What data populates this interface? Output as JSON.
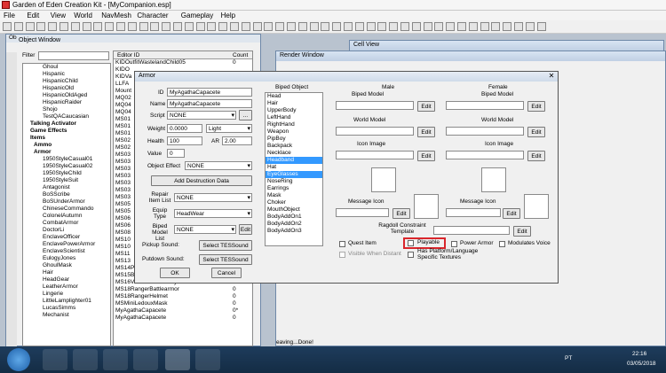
{
  "app": {
    "title": "Garden of Eden Creation Kit - [MyCompanion.esp]"
  },
  "menu": [
    "File",
    "Edit",
    "View",
    "World",
    "NavMesh",
    "Character",
    "Gameplay",
    "Help"
  ],
  "object_window": {
    "title": "Object Window",
    "filter_label": "Filter",
    "tree": [
      "Ghoul",
      "Hispanic",
      "HispanicChild",
      "HispanicOld",
      "HispanicOldAged",
      "HispanicRaider",
      "Shojo",
      "TestQACaucasian",
      "Talking Activator",
      "Game Effects",
      "Items",
      "Ammo",
      "Armor",
      "1950StyleCasual01",
      "1950StyleCasual02",
      "1950StyleChild",
      "1950StyleSuit",
      "Antagonist",
      "BoSScribe",
      "BoSUnderArmor",
      "ChineseCommando",
      "ColonelAutumn",
      "CombatArmor",
      "DoctorLi",
      "EnclaveOfficer",
      "EnclavePowerArmor",
      "EnclaveScientist",
      "EulogyJones",
      "GhoulMask",
      "Hair",
      "HeadGear",
      "LeatherArmor",
      "Lingerie",
      "LittleLamplighter01",
      "LucasSimms",
      "Mechanist"
    ],
    "col_editor_id": "Editor ID",
    "col_count": "Count",
    "list": [
      {
        "id": "KIDOutfitWastelandChild05",
        "count": "0"
      },
      {
        "id": "KIDO",
        "count": ""
      },
      {
        "id": "KIDVa",
        "count": ""
      },
      {
        "id": "LLFA",
        "count": ""
      },
      {
        "id": "Mount",
        "count": ""
      },
      {
        "id": "MQ02",
        "count": ""
      },
      {
        "id": "MQ04",
        "count": ""
      },
      {
        "id": "MQ04",
        "count": ""
      },
      {
        "id": "MS01",
        "count": ""
      },
      {
        "id": "MS01",
        "count": ""
      },
      {
        "id": "MS01",
        "count": ""
      },
      {
        "id": "MS02",
        "count": ""
      },
      {
        "id": "MS02",
        "count": ""
      },
      {
        "id": "MS03",
        "count": ""
      },
      {
        "id": "MS03",
        "count": ""
      },
      {
        "id": "MS03",
        "count": ""
      },
      {
        "id": "MS03",
        "count": ""
      },
      {
        "id": "MS03",
        "count": ""
      },
      {
        "id": "MS03",
        "count": ""
      },
      {
        "id": "MS03",
        "count": ""
      },
      {
        "id": "MS05",
        "count": ""
      },
      {
        "id": "MS05",
        "count": ""
      },
      {
        "id": "MS06",
        "count": ""
      },
      {
        "id": "MS06",
        "count": ""
      },
      {
        "id": "MS08",
        "count": ""
      },
      {
        "id": "MS10",
        "count": ""
      },
      {
        "id": "MS10",
        "count": ""
      },
      {
        "id": "MS11",
        "count": ""
      },
      {
        "id": "MS13",
        "count": ""
      },
      {
        "id": "MS14PornBoredRosphrhe",
        "count": "0"
      },
      {
        "id": "MS15ButtonsWig",
        "count": "0"
      },
      {
        "id": "MS16VaultSuit101Utility",
        "count": "0"
      },
      {
        "id": "MS18RangerBattlearmor",
        "count": "0"
      },
      {
        "id": "MS18RangerHelmet",
        "count": "0"
      },
      {
        "id": "MSMiniLedouxMask",
        "count": "0"
      },
      {
        "id": "MyAgathaCapacete",
        "count": "0*"
      },
      {
        "id": "MyAgathaCapacete",
        "count": "0"
      }
    ]
  },
  "cell_view": {
    "title": "Cell View"
  },
  "render_window": {
    "title": "Render Window"
  },
  "status": "eaving...Done!",
  "armor_dialog": {
    "title": "Armor",
    "id_label": "ID",
    "id_value": "MyAgathaCapacete",
    "name_label": "Name",
    "name_value": "MyAgathaCapacete",
    "script_label": "Script",
    "script_value": "NONE",
    "weight_label": "Weight",
    "weight_value": "0.0000",
    "weight_type": "Light",
    "health_label": "Health",
    "health_value": "100",
    "ar_label": "AR",
    "ar_value": "2.00",
    "value_label": "Value",
    "value_value": "0",
    "object_effect_label": "Object Effect",
    "object_effect_value": "NONE",
    "add_destruction": "Add Destruction Data",
    "repair_label": "Repair Item List",
    "repair_value": "NONE",
    "equip_label": "Equip Type",
    "equip_value": "HeadWear",
    "biped_model_label": "Biped Model List",
    "biped_model_value": "NONE",
    "edit": "Edit",
    "pickup_label": "Pickup Sound:",
    "putdown_label": "Putdown Sound:",
    "select_sound": "Select TESSound",
    "ok": "OK",
    "cancel": "Cancel",
    "biped_object_label": "Biped Object",
    "biped_objects": [
      "Head",
      "Hair",
      "UpperBody",
      "LeftHand",
      "RightHand",
      "Weapon",
      "PipBoy",
      "Backpack",
      "Necklace",
      "Headband",
      "Hat",
      "EyeGlasses",
      "NoseRing",
      "Earrings",
      "Mask",
      "Choker",
      "MouthObject",
      "BodyAddOn1",
      "BodyAddOn2",
      "BodyAddOn3"
    ],
    "biped_selected": [
      "Headband",
      "EyeGlasses"
    ],
    "male_label": "Male",
    "female_label": "Female",
    "biped_model": "Biped Model",
    "world_model": "World Model",
    "icon_image": "Icon Image",
    "message_icon": "Message Icon",
    "ragdoll_label": "Ragdoll Constraint Template",
    "quest_item": "Quest Item",
    "playable": "Playable",
    "power_armor": "Power Armor",
    "modulates_voice": "Modulates Voice",
    "visible_when_distant": "Visible When Distant",
    "has_platform": "Has Platform/Language Specific Textures",
    "highlight_color": "#d9262c",
    "selection_color": "#3399ff"
  },
  "taskbar": {
    "lang": "PT",
    "time": "22:16",
    "date": "03/05/2018"
  }
}
